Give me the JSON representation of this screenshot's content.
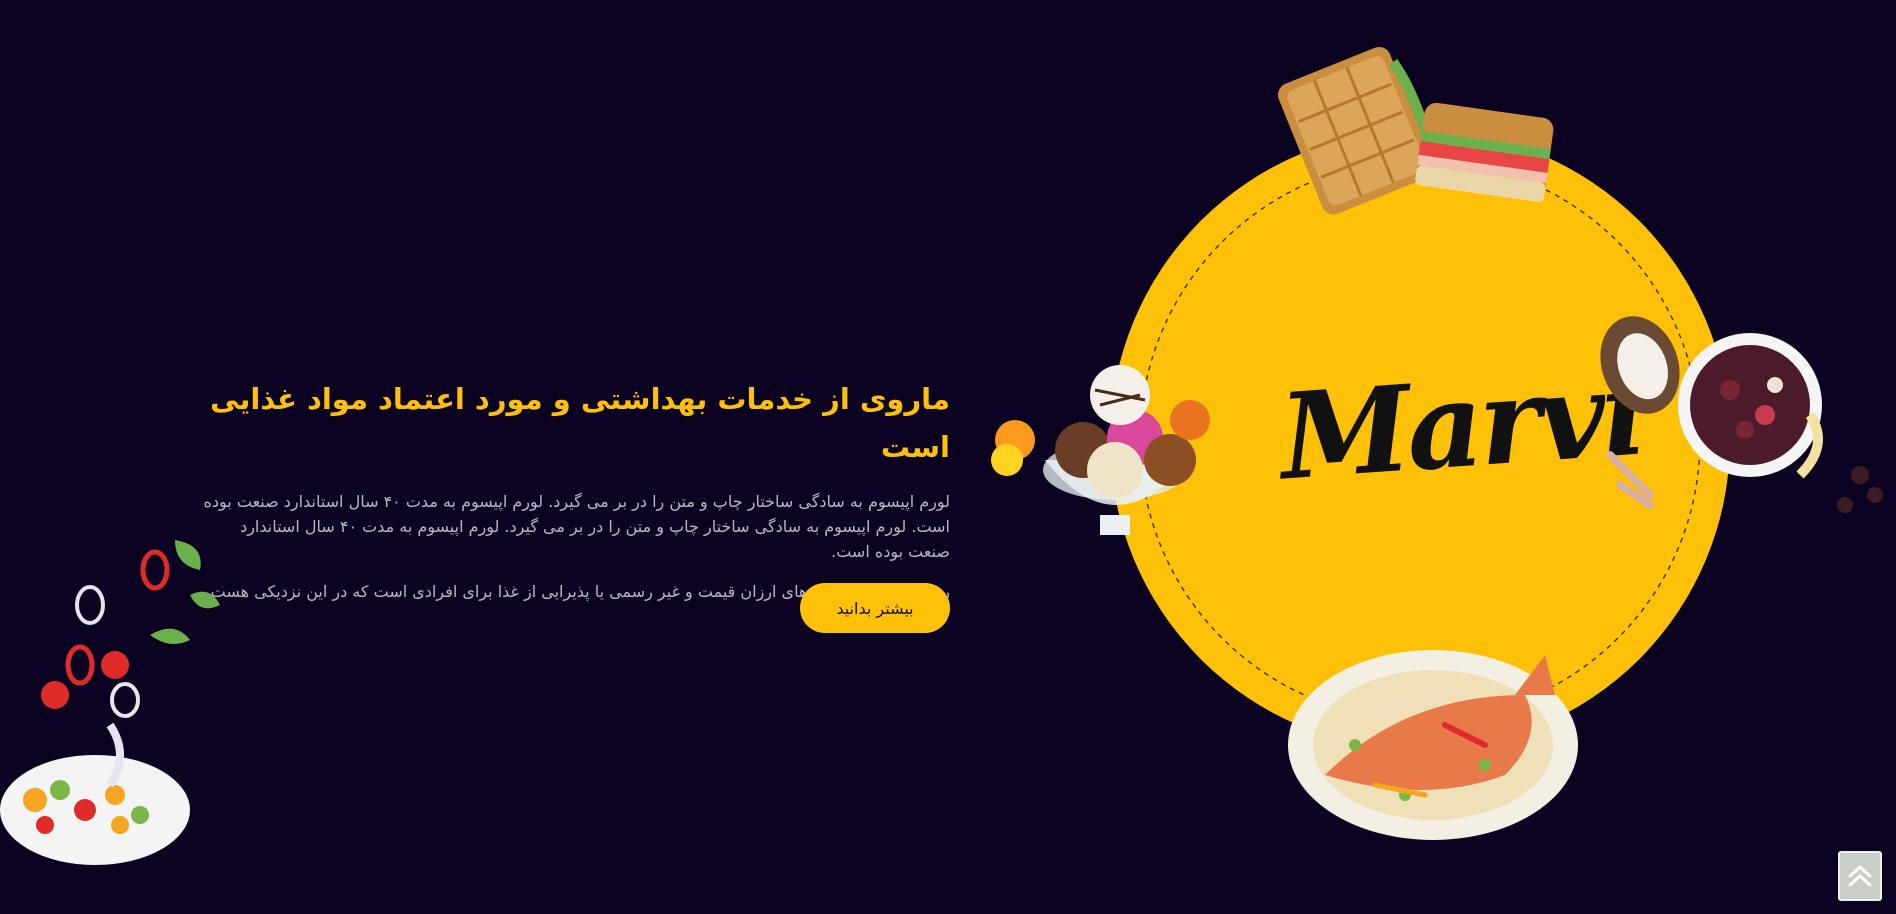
{
  "hero": {
    "title": "ماروی از خدمات بهداشتی و مورد اعتماد مواد غذایی است",
    "description": "لورم اپیسوم به سادگی ساختار چاپ و متن را در بر می گیرد. لورم اپیسوم به مدت ۴۰ سال استاندارد صنعت بوده است. لورم اپیسوم به سادگی ساختار چاپ و متن را در بر می گیرد. لورم اپیسوم به مدت ۴۰ سال استاندارد صنعت بوده است.",
    "subtext": "رستورانها شامل ناهارهای ارزان قیمت و غیر رسمی یا پذیرایی از غذا برای افرادی است که در این نزدیکی هست",
    "button_label": "بیشتر بدانید"
  },
  "brand": {
    "logo_text": "Marvi"
  },
  "colors": {
    "background": "#0b0221",
    "accent": "#ffc107",
    "body_text": "#b9b6c6"
  },
  "icons": {
    "back_to_top": "double-chevron-up-icon"
  }
}
